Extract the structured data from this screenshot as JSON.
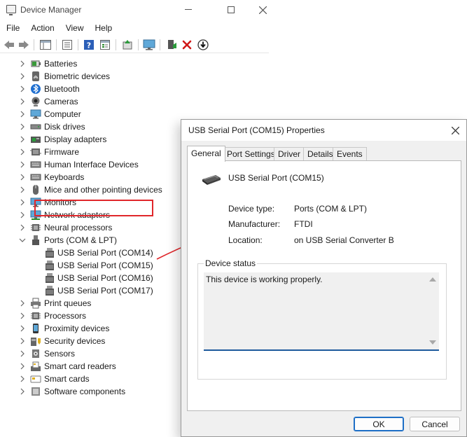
{
  "device_manager": {
    "title": "Device Manager",
    "menu": [
      "File",
      "Action",
      "View",
      "Help"
    ],
    "tree": [
      {
        "label": "Batteries",
        "icon": "battery-icon"
      },
      {
        "label": "Biometric devices",
        "icon": "fingerprint-icon"
      },
      {
        "label": "Bluetooth",
        "icon": "bluetooth-icon"
      },
      {
        "label": "Cameras",
        "icon": "camera-icon"
      },
      {
        "label": "Computer",
        "icon": "monitor-icon"
      },
      {
        "label": "Disk drives",
        "icon": "disk-drive-icon"
      },
      {
        "label": "Display adapters",
        "icon": "display-adapter-icon"
      },
      {
        "label": "Firmware",
        "icon": "firmware-icon"
      },
      {
        "label": "Human Interface Devices",
        "icon": "keyboard-hid-icon"
      },
      {
        "label": "Keyboards",
        "icon": "keyboard-icon"
      },
      {
        "label": "Mice and other pointing devices",
        "icon": "mouse-icon"
      },
      {
        "label": "Monitors",
        "icon": "monitor-icon"
      },
      {
        "label": "Network adapters",
        "icon": "network-adapter-icon"
      },
      {
        "label": "Neural processors",
        "icon": "chip-icon"
      },
      {
        "label": "Ports (COM & LPT)",
        "icon": "port-icon",
        "expanded": true
      },
      {
        "label": "USB Serial Port (COM14)",
        "icon": "serial-port-icon",
        "child": true
      },
      {
        "label": "USB Serial Port (COM15)",
        "icon": "serial-port-icon",
        "child": true,
        "selected": true
      },
      {
        "label": "USB Serial Port (COM16)",
        "icon": "serial-port-icon",
        "child": true
      },
      {
        "label": "USB Serial Port (COM17)",
        "icon": "serial-port-icon",
        "child": true
      },
      {
        "label": "Print queues",
        "icon": "printer-icon"
      },
      {
        "label": "Processors",
        "icon": "chip-icon"
      },
      {
        "label": "Proximity devices",
        "icon": "phone-icon"
      },
      {
        "label": "Security devices",
        "icon": "security-icon"
      },
      {
        "label": "Sensors",
        "icon": "sensor-icon"
      },
      {
        "label": "Smart card readers",
        "icon": "card-reader-icon"
      },
      {
        "label": "Smart cards",
        "icon": "smart-card-icon"
      },
      {
        "label": "Software components",
        "icon": "software-icon"
      }
    ]
  },
  "dialog": {
    "title": "USB Serial Port (COM15) Properties",
    "tabs": [
      "General",
      "Port Settings",
      "Driver",
      "Details",
      "Events"
    ],
    "active_tab": "General",
    "device_name": "USB Serial Port (COM15)",
    "properties": [
      {
        "label": "Device type:",
        "value": "Ports (COM & LPT)"
      },
      {
        "label": "Manufacturer:",
        "value": "FTDI"
      },
      {
        "label": "Location:",
        "value": "on USB Serial Converter B"
      }
    ],
    "status_legend": "Device status",
    "status_text": "This device is working properly.",
    "ok_label": "OK",
    "cancel_label": "Cancel"
  },
  "colors": {
    "highlight_box": "#e0272b",
    "annotation_arrow": "#e0272b",
    "ok_border": "#1e6fc6"
  }
}
